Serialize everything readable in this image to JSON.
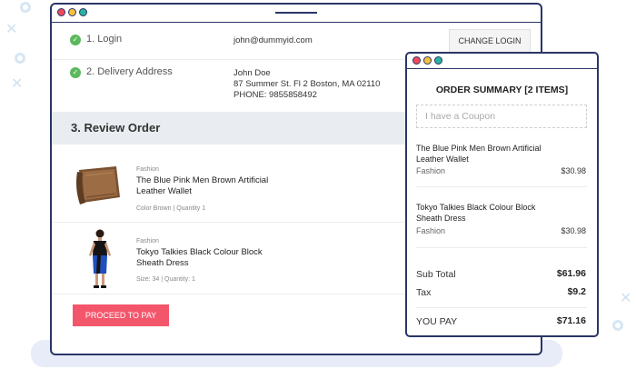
{
  "steps": [
    {
      "label": "1. Login",
      "value": "john@dummyid.com",
      "button": "CHANGE LOGIN"
    },
    {
      "label": "2. Delivery Address",
      "lines": [
        "John Doe",
        "87 Summer St. Fl 2 Boston, MA 02110",
        "PHONE: 9855858492"
      ]
    }
  ],
  "review": {
    "title": "3. Review Order",
    "items": [
      {
        "category": "Fashion",
        "name_line1": "The Blue Pink Men Brown Artificial",
        "name_line2": "Leather Wallet",
        "meta": "Color Brown | Quantity 1",
        "image": "wallet"
      },
      {
        "category": "Fashion",
        "name_line1": "Tokyo Talkies Black Colour Block",
        "name_line2": "Sheath Dress",
        "meta": "Size: 34 | Quantity: 1",
        "image": "dress"
      }
    ],
    "pay_button": "PROCEED TO PAY"
  },
  "summary": {
    "title": "ORDER SUMMARY [2 ITEMS]",
    "coupon_placeholder": "I have a Coupon",
    "items": [
      {
        "name_line1": "The Blue Pink Men Brown Artificial",
        "name_line2": "Leather Wallet",
        "category": "Fashion",
        "price": "$30.98"
      },
      {
        "name_line1": "Tokyo Talkies Black Colour Block",
        "name_line2": "Sheath Dress",
        "category": "Fashion",
        "price": "$30.98"
      }
    ],
    "subtotal_label": "Sub Total",
    "subtotal": "$61.96",
    "tax_label": "Tax",
    "tax": "$9.2",
    "pay_label": "YOU PAY",
    "pay": "$71.16"
  },
  "colors": {
    "accent": "#f3566b",
    "frame": "#2b3566",
    "check": "#5cb85c"
  }
}
